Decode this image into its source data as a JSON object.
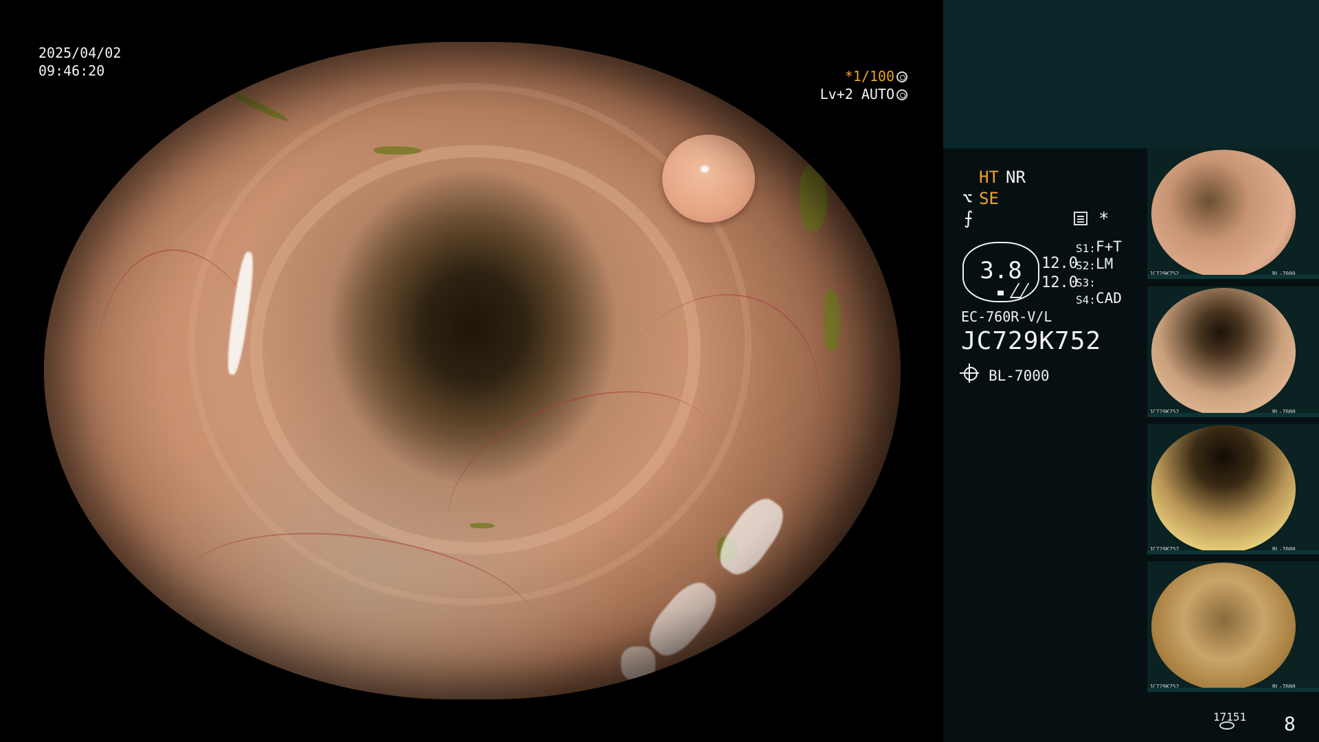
{
  "overlay": {
    "date": "2025/04/02",
    "time": "09:46:20",
    "shutter": "*1/100",
    "enhance": "Lv+2",
    "iris": "AUTO"
  },
  "panel": {
    "mode_ht": "HT",
    "mode_nr": "NR",
    "mode_se": "SE",
    "se_icon": "⌥",
    "sharp_icon": "⨍",
    "asterisk": "*",
    "ratio": "3.8",
    "value_a": "12.0",
    "value_b": "12.0",
    "switches": [
      {
        "label": "S1:",
        "value": "F+T"
      },
      {
        "label": "S2:",
        "value": "LM"
      },
      {
        "label": "S3:",
        "value": ""
      },
      {
        "label": "S4:",
        "value": "CAD"
      }
    ],
    "scope_model": "EC-760R-V/L",
    "scope_serial": "JC729K752",
    "light_source": "BL-7000"
  },
  "thumbnails": [
    {
      "serial": "JC729K752",
      "model": "BL-7000"
    },
    {
      "serial": "JC729K752",
      "model": "BL-7000"
    },
    {
      "serial": "JC729K752",
      "model": "BL-7000"
    },
    {
      "serial": "JC729K752",
      "model": "BL-7000"
    }
  ],
  "footer": {
    "image_count": "17151",
    "page": "8"
  },
  "colors": {
    "panel_bg": "#061012",
    "panel_top": "#0a2629",
    "accent": "#f0a22e"
  }
}
